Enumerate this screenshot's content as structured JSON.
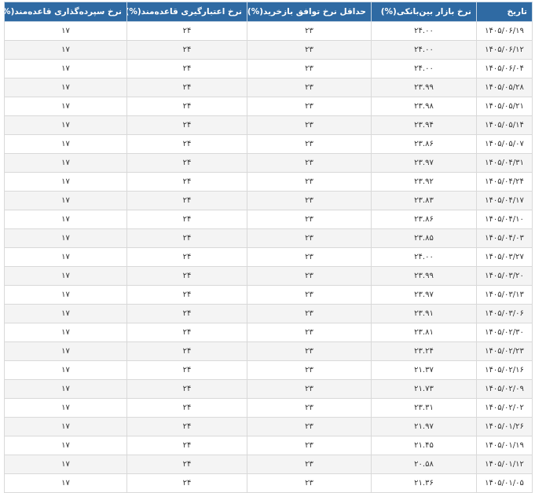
{
  "table": {
    "headers": [
      "تاریخ",
      "نرخ بازار بین‌بانکی(%)",
      "حداقل نرخ توافق بازخرید(%)",
      "نرخ اعتبارگیری قاعده‌مند(%)",
      "نرخ سپرده‌گذاری قاعده‌مند(%)"
    ],
    "rows": [
      [
        "۱۴۰۵/۰۶/۱۹",
        "۲۴.۰۰",
        "۲۳",
        "۲۴",
        "۱۷"
      ],
      [
        "۱۴۰۵/۰۶/۱۲",
        "۲۴.۰۰",
        "۲۳",
        "۲۴",
        "۱۷"
      ],
      [
        "۱۴۰۵/۰۶/۰۴",
        "۲۴.۰۰",
        "۲۳",
        "۲۴",
        "۱۷"
      ],
      [
        "۱۴۰۵/۰۵/۲۸",
        "۲۳.۹۹",
        "۲۳",
        "۲۴",
        "۱۷"
      ],
      [
        "۱۴۰۵/۰۵/۲۱",
        "۲۳.۹۸",
        "۲۳",
        "۲۴",
        "۱۷"
      ],
      [
        "۱۴۰۵/۰۵/۱۴",
        "۲۳.۹۴",
        "۲۳",
        "۲۴",
        "۱۷"
      ],
      [
        "۱۴۰۵/۰۵/۰۷",
        "۲۳.۸۶",
        "۲۳",
        "۲۴",
        "۱۷"
      ],
      [
        "۱۴۰۵/۰۴/۳۱",
        "۲۳.۹۷",
        "۲۳",
        "۲۴",
        "۱۷"
      ],
      [
        "۱۴۰۵/۰۴/۲۴",
        "۲۳.۹۲",
        "۲۳",
        "۲۴",
        "۱۷"
      ],
      [
        "۱۴۰۵/۰۴/۱۷",
        "۲۳.۸۳",
        "۲۳",
        "۲۴",
        "۱۷"
      ],
      [
        "۱۴۰۵/۰۴/۱۰",
        "۲۳.۸۶",
        "۲۳",
        "۲۴",
        "۱۷"
      ],
      [
        "۱۴۰۵/۰۴/۰۳",
        "۲۳.۸۵",
        "۲۳",
        "۲۴",
        "۱۷"
      ],
      [
        "۱۴۰۵/۰۳/۲۷",
        "۲۴.۰۰",
        "۲۳",
        "۲۴",
        "۱۷"
      ],
      [
        "۱۴۰۵/۰۳/۲۰",
        "۲۳.۹۹",
        "۲۳",
        "۲۴",
        "۱۷"
      ],
      [
        "۱۴۰۵/۰۳/۱۳",
        "۲۳.۹۷",
        "۲۳",
        "۲۴",
        "۱۷"
      ],
      [
        "۱۴۰۵/۰۳/۰۶",
        "۲۳.۹۱",
        "۲۳",
        "۲۴",
        "۱۷"
      ],
      [
        "۱۴۰۵/۰۲/۳۰",
        "۲۳.۸۱",
        "۲۳",
        "۲۴",
        "۱۷"
      ],
      [
        "۱۴۰۵/۰۲/۲۳",
        "۲۳.۲۴",
        "۲۳",
        "۲۴",
        "۱۷"
      ],
      [
        "۱۴۰۵/۰۲/۱۶",
        "۲۱.۳۷",
        "۲۳",
        "۲۴",
        "۱۷"
      ],
      [
        "۱۴۰۵/۰۲/۰۹",
        "۲۱.۷۳",
        "۲۳",
        "۲۴",
        "۱۷"
      ],
      [
        "۱۴۰۵/۰۲/۰۲",
        "۲۳.۳۱",
        "۲۳",
        "۲۴",
        "۱۷"
      ],
      [
        "۱۴۰۵/۰۱/۲۶",
        "۲۱.۹۷",
        "۲۳",
        "۲۴",
        "۱۷"
      ],
      [
        "۱۴۰۵/۰۱/۱۹",
        "۲۱.۴۵",
        "۲۳",
        "۲۴",
        "۱۷"
      ],
      [
        "۱۴۰۵/۰۱/۱۲",
        "۲۰.۵۸",
        "۲۳",
        "۲۴",
        "۱۷"
      ],
      [
        "۱۴۰۵/۰۱/۰۵",
        "۲۱.۳۶",
        "۲۳",
        "۲۴",
        "۱۷"
      ]
    ]
  },
  "colors": {
    "header_bg": "#2f6aa3",
    "header_text": "#ffffff",
    "row_alt_bg": "#f4f4f4",
    "border": "#d9d9d9"
  }
}
